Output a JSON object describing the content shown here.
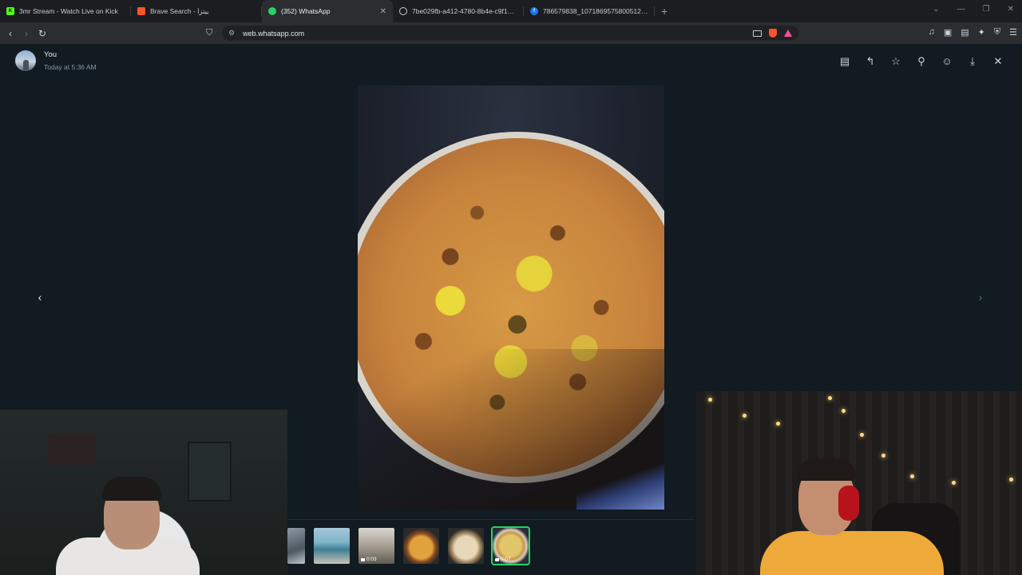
{
  "browser": {
    "tabs": [
      {
        "title": "3mr Stream - Watch Live on Kick",
        "favicon": "kick-icon",
        "color": "#53fc18"
      },
      {
        "title": "Brave Search - بيتزا",
        "favicon": "brave-icon",
        "color": "#fb542b"
      },
      {
        "title": "(352) WhatsApp",
        "favicon": "whatsapp-icon",
        "color": "#25d366",
        "active": true
      },
      {
        "title": "7be029fb-a412-4780-8b4e-c9f1d87a",
        "favicon": "globe-icon",
        "color": "#c9cbd0"
      },
      {
        "title": "786579838_1071869575800512_791",
        "favicon": "facebook-icon",
        "color": "#1877f2"
      }
    ],
    "new_tab": "+",
    "url": "web.whatsapp.com"
  },
  "viewer": {
    "sender": "You",
    "timestamp": "Today at 5:36 AM",
    "actions": [
      "caption-icon",
      "reply-icon",
      "star-icon",
      "pin-icon",
      "emoji-icon",
      "download-icon",
      "close-icon"
    ],
    "thumbnails": [
      {
        "name": "thumb-1",
        "duration": ""
      },
      {
        "name": "thumb-2",
        "duration": ""
      },
      {
        "name": "thumb-3",
        "duration": "0:03"
      },
      {
        "name": "thumb-4",
        "duration": ""
      },
      {
        "name": "thumb-5",
        "duration": ""
      },
      {
        "name": "thumb-6",
        "duration": "0:07",
        "selected": true
      }
    ],
    "accent": "#25d366"
  }
}
